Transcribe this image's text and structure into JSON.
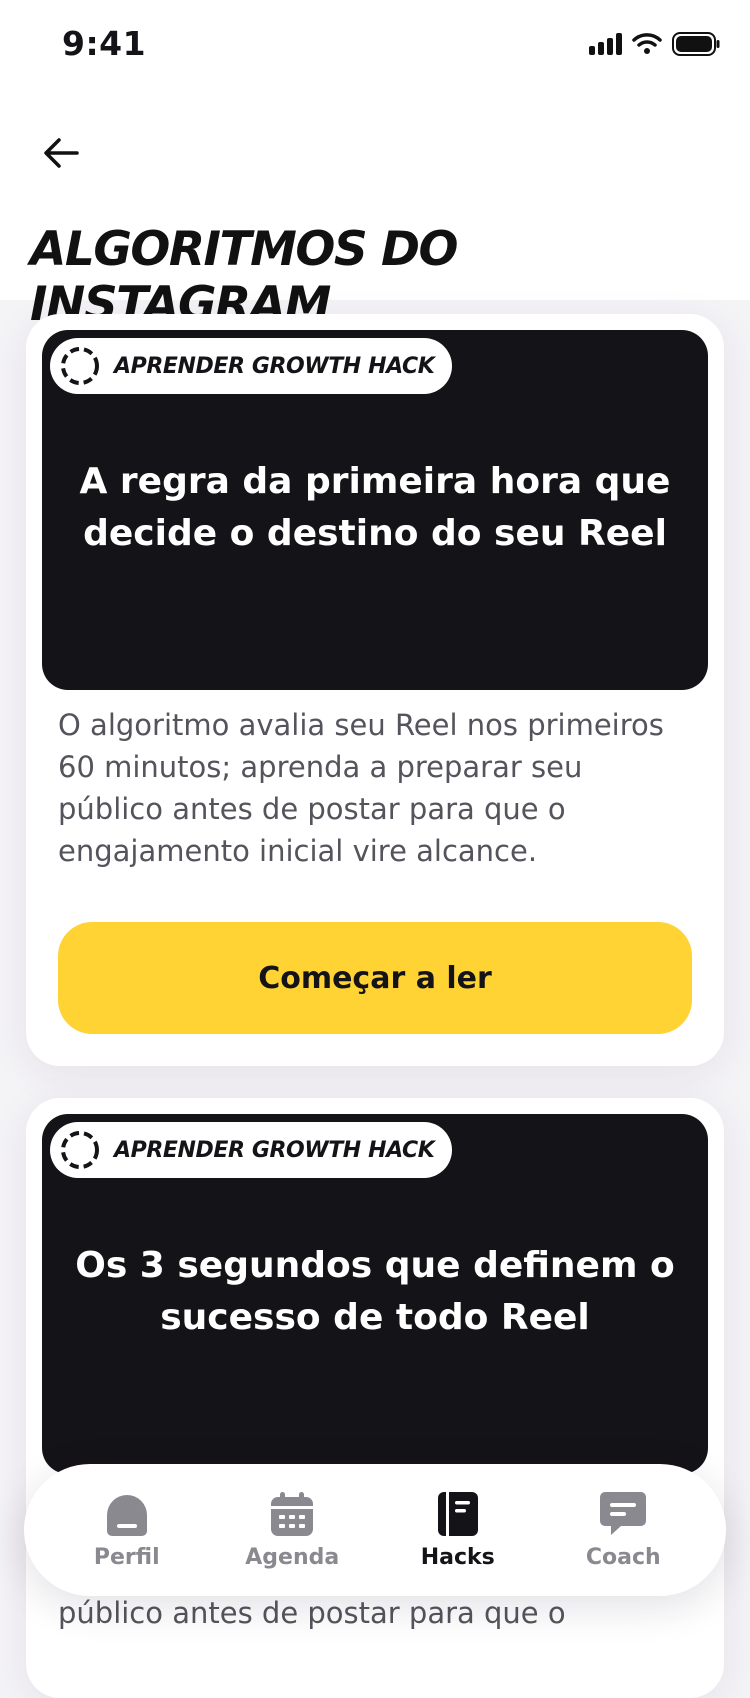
{
  "status_bar": {
    "time": "9:41"
  },
  "header": {
    "title": "ALGORITMOS DO INSTAGRAM"
  },
  "cards": [
    {
      "badge": "APRENDER GROWTH HACK",
      "title": "A regra da primeira hora que decide o destino do seu Reel",
      "description": "O algoritmo avalia seu Reel nos primeiros 60 minutos; aprenda a preparar seu público antes de postar para que o engajamento inicial vire alcance.",
      "cta": "Começar a ler"
    },
    {
      "badge": "APRENDER GROWTH HACK",
      "title": "Os 3 segundos que definem o sucesso de todo Reel",
      "description_peek": "público antes de postar para que o"
    }
  ],
  "tabbar": {
    "items": [
      {
        "label": "Perfil",
        "icon": "home-icon"
      },
      {
        "label": "Agenda",
        "icon": "calendar-icon"
      },
      {
        "label": "Hacks",
        "icon": "book-icon",
        "active": true
      },
      {
        "label": "Coach",
        "icon": "chat-icon"
      }
    ]
  },
  "colors": {
    "accent": "#FFD334",
    "dark": "#141317",
    "muted": "#8A8990"
  }
}
